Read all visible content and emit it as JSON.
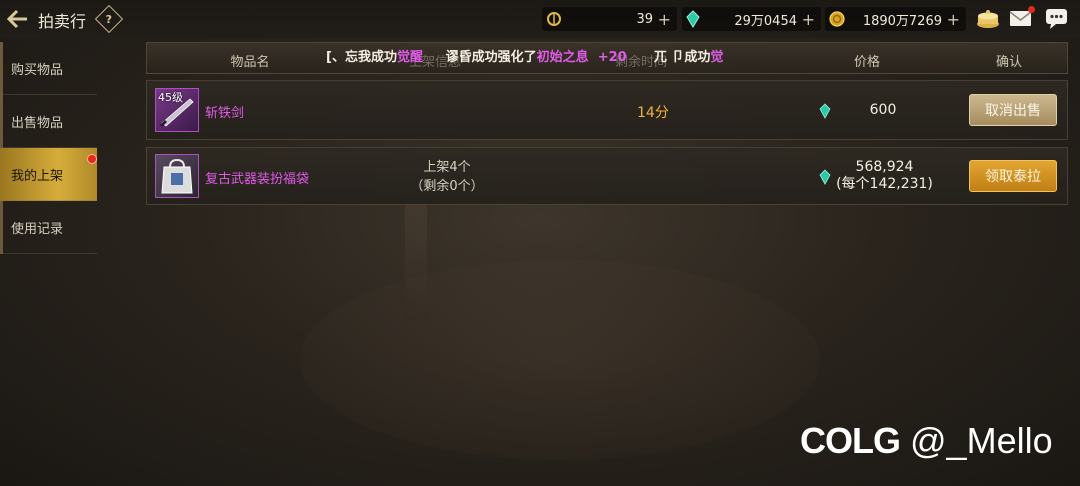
{
  "header": {
    "title": "拍卖行",
    "help_icon": "?",
    "currencies": [
      {
        "icon": "coupon-icon",
        "value": "39",
        "plus": "+"
      },
      {
        "icon": "gem-icon",
        "value": "29万0454",
        "plus": "+"
      },
      {
        "icon": "gold-coin-icon",
        "value": "1890万7269",
        "plus": "+"
      }
    ]
  },
  "sidenav": {
    "items": [
      {
        "label": "购买物品"
      },
      {
        "label": "出售物品"
      },
      {
        "label": "我的上架"
      },
      {
        "label": "使用记录"
      }
    ]
  },
  "table": {
    "headers": [
      "物品名",
      "上架信息",
      "剩余时间",
      "价格",
      "确认"
    ],
    "rows": [
      {
        "level": "45级",
        "name": "斩铁剑",
        "time_left": "14分",
        "price": "600",
        "button": "取消出售"
      },
      {
        "name": "复古武器装扮福袋",
        "listed_line1": "上架4个",
        "listed_line2": "（剩余0个）",
        "price": "568,924",
        "price_each": "(每个142,231)",
        "button": "领取泰拉"
      }
    ]
  },
  "ticker": {
    "part1": "[、忘我成功",
    "part2": "觉醒",
    "part3": "谬昏成功强化了",
    "part4": "初始之息",
    "part5": "+20",
    "part6": "兀 卩成功",
    "part7": "觉"
  },
  "watermark": {
    "logo": "COLG",
    "handle": "@_Mello"
  },
  "colors": {
    "accent_gold": "#d6ad3a",
    "item_name_purple": "#e05ce8",
    "time_orange": "#f0b43a"
  }
}
